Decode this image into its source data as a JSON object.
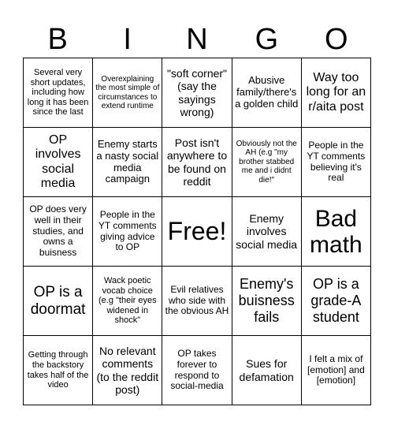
{
  "header": [
    "B",
    "I",
    "N",
    "G",
    "O"
  ],
  "cells": [
    [
      "Several very short updates, including how long it has been since the last",
      "Overexplaining the most simple of circumstances to extend runtime",
      "\"soft corner\" (say the sayings wrong)",
      "Abusive family/there's a golden child",
      "Way too long for an r/aita post"
    ],
    [
      "OP involves social media",
      "Enemy starts a nasty social media campaign",
      "Post isn't anywhere to be found on reddit",
      "Obviously not the AH (e.g \"my brother stabbed me and i didnt die!\"",
      "People in the YT comments believing it's real"
    ],
    [
      "OP does very well in their studies, and owns a buisness",
      "People in the YT comments giving advice to OP",
      "Free!",
      "Enemy involves social media",
      "Bad math"
    ],
    [
      "OP is a doormat",
      "Wack poetic vocab choice (e.g \"their eyes widened in shock\"",
      "Evil relatives who side with the obvious AH",
      "Enemy's buisness fails",
      "OP is a grade-A student"
    ],
    [
      "Getting through the backstory takes half of the video",
      "No relevant comments (to the reddit post)",
      "OP takes forever to respond to social-media",
      "Sues for defamation",
      "I felt a mix of [emotion] and [emotion]"
    ]
  ]
}
